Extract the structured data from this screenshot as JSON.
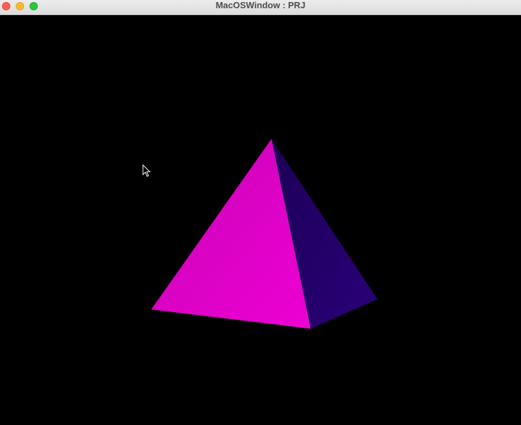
{
  "window": {
    "title": "MacOSWindow : PRJ",
    "controls": [
      "close",
      "minimize",
      "zoom"
    ]
  },
  "scene": {
    "object": "pyramid",
    "colors": {
      "front_face": "#e600c8",
      "side_face": "#22006a",
      "background": "#000000"
    }
  },
  "cursor": {
    "icon": "arrow-pointer-icon"
  }
}
